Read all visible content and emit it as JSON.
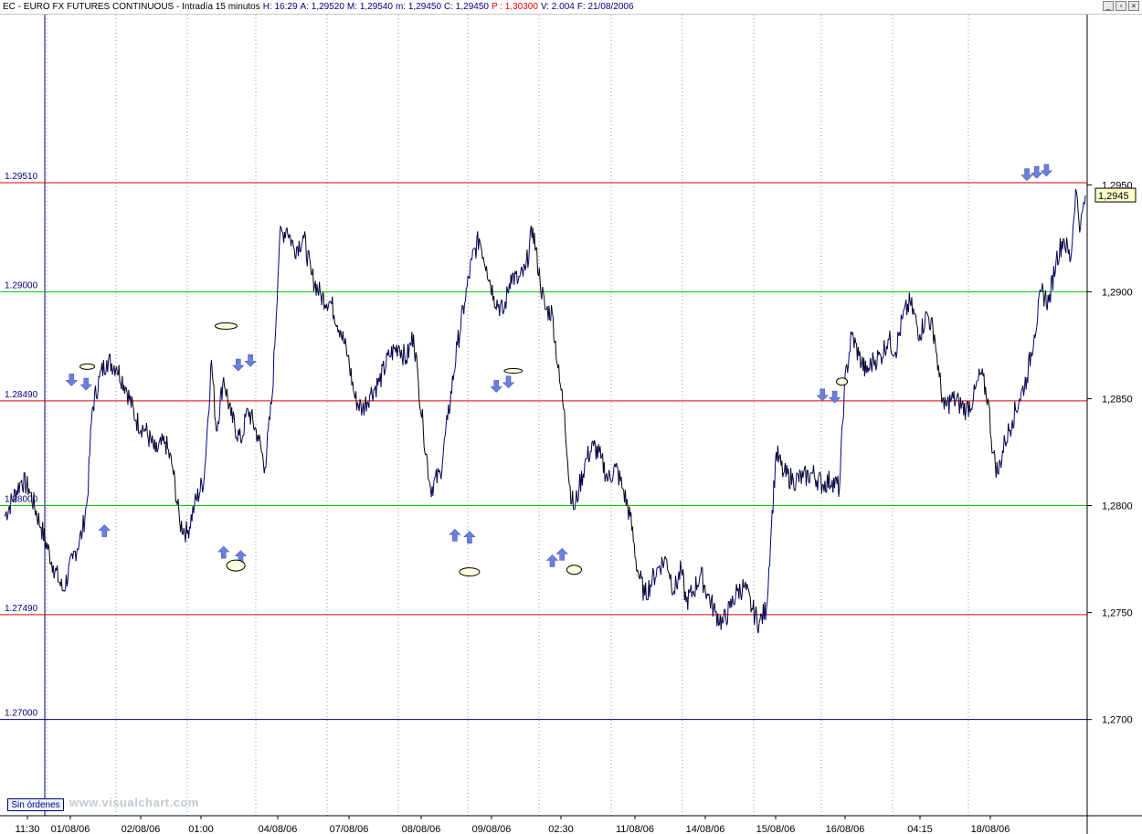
{
  "window": {
    "title_parts": [
      {
        "label": "EC - EURO FX FUTURES CONTINUOUS - Intradía 15 minutos",
        "value": "",
        "color": "#000000"
      },
      {
        "label": "H:",
        "value": "16:29",
        "color": "#000080"
      },
      {
        "label": "A:",
        "value": "1,29520",
        "color": "#000080"
      },
      {
        "label": "M:",
        "value": "1,29540",
        "color": "#000080"
      },
      {
        "label": "m:",
        "value": "1,29450",
        "color": "#000080"
      },
      {
        "label": "C:",
        "value": "1,29450",
        "color": "#000080"
      },
      {
        "label": "P :",
        "value": "1,30300",
        "color": "#ff0000"
      },
      {
        "label": "V:",
        "value": "2.004",
        "color": "#000080"
      },
      {
        "label": "F:",
        "value": "21/08/2006",
        "color": "#000080"
      }
    ],
    "buttons": [
      "_",
      "▫",
      "×"
    ]
  },
  "footer": {
    "orders_button": "Sin órdenes",
    "watermark": "www.visualchart.com"
  },
  "colors": {
    "bull": "#000080",
    "bear": "#000000",
    "red_level": "#e00000",
    "green_level": "#00c000",
    "blue_level": "#000080",
    "signal": "#6c7fd8"
  },
  "chart_data": {
    "type": "line",
    "title": "EC - EURO FX FUTURES CONTINUOUS - Intradía 15 minutos",
    "ylim": [
      1.2655,
      1.30296
    ],
    "last_value": 1.2945,
    "last_value_label": "1,2945",
    "y_ticks": [
      {
        "value": 1.295,
        "label": "1,2950"
      },
      {
        "value": 1.29,
        "label": "1,2900"
      },
      {
        "value": 1.285,
        "label": "1,2850"
      },
      {
        "value": 1.28,
        "label": "1,2800"
      },
      {
        "value": 1.275,
        "label": "1,2750"
      },
      {
        "value": 1.27,
        "label": "1,2700"
      }
    ],
    "x_ticks": [
      "11:30",
      "01/08/06",
      "02/08/06",
      "01:00",
      "04/08/06",
      "07/08/06",
      "08/08/06",
      "09/08/06",
      "02:30",
      "11/08/06",
      "14/08/06",
      "15/08/06",
      "16/08/06",
      "04:15",
      "18/08/06"
    ],
    "levels": [
      {
        "value": 1.2951,
        "label": "1.29510",
        "color": "red"
      },
      {
        "value": 1.29,
        "label": "1.29000",
        "color": "green"
      },
      {
        "value": 1.2849,
        "label": "1.28490",
        "color": "red"
      },
      {
        "value": 1.28,
        "label": "1.28000",
        "color": "green"
      },
      {
        "value": 1.2749,
        "label": "1.27490",
        "color": "red"
      },
      {
        "value": 1.27,
        "label": "1.27000",
        "color": "blue"
      }
    ],
    "series_path": [
      [
        0,
        1.2795
      ],
      [
        0.7,
        1.2812
      ],
      [
        1.0,
        1.2808
      ],
      [
        1.5,
        1.279
      ],
      [
        2.0,
        1.2772
      ],
      [
        2.4,
        1.276
      ],
      [
        2.8,
        1.2775
      ],
      [
        3.2,
        1.2788
      ],
      [
        3.4,
        1.2803
      ],
      [
        3.6,
        1.2845
      ],
      [
        3.9,
        1.286
      ],
      [
        4.2,
        1.2868
      ],
      [
        4.6,
        1.2865
      ],
      [
        5.0,
        1.2855
      ],
      [
        5.4,
        1.284
      ],
      [
        5.8,
        1.2835
      ],
      [
        6.2,
        1.2825
      ],
      [
        6.6,
        1.283
      ],
      [
        6.9,
        1.2818
      ],
      [
        7.2,
        1.2792
      ],
      [
        7.5,
        1.2787
      ],
      [
        7.8,
        1.28
      ],
      [
        8.2,
        1.2813
      ],
      [
        8.5,
        1.2868
      ],
      [
        8.7,
        1.2835
      ],
      [
        9.0,
        1.286
      ],
      [
        9.3,
        1.2842
      ],
      [
        9.7,
        1.283
      ],
      [
        10.0,
        1.2845
      ],
      [
        10.4,
        1.2833
      ],
      [
        10.7,
        1.2818
      ],
      [
        11.0,
        1.2852
      ],
      [
        11.3,
        1.2925
      ],
      [
        11.6,
        1.293
      ],
      [
        11.9,
        1.292
      ],
      [
        12.3,
        1.2925
      ],
      [
        12.6,
        1.2908
      ],
      [
        13.0,
        1.2898
      ],
      [
        13.4,
        1.2895
      ],
      [
        13.8,
        1.2882
      ],
      [
        14.1,
        1.287
      ],
      [
        14.4,
        1.285
      ],
      [
        14.7,
        1.2845
      ],
      [
        15.0,
        1.2852
      ],
      [
        15.4,
        1.2858
      ],
      [
        15.8,
        1.287
      ],
      [
        16.2,
        1.2875
      ],
      [
        16.5,
        1.2868
      ],
      [
        16.8,
        1.288
      ],
      [
        17.0,
        1.2858
      ],
      [
        17.2,
        1.2836
      ],
      [
        17.5,
        1.2808
      ],
      [
        17.9,
        1.2815
      ],
      [
        18.2,
        1.284
      ],
      [
        18.6,
        1.2875
      ],
      [
        18.9,
        1.2895
      ],
      [
        19.2,
        1.2915
      ],
      [
        19.5,
        1.2925
      ],
      [
        19.8,
        1.2912
      ],
      [
        20.1,
        1.2898
      ],
      [
        20.5,
        1.289
      ],
      [
        20.8,
        1.2908
      ],
      [
        21.1,
        1.2905
      ],
      [
        21.4,
        1.291
      ],
      [
        21.7,
        1.293
      ],
      [
        22.0,
        1.2905
      ],
      [
        22.2,
        1.2892
      ],
      [
        22.5,
        1.289
      ],
      [
        22.8,
        1.2858
      ],
      [
        23.0,
        1.2845
      ],
      [
        23.2,
        1.281
      ],
      [
        23.4,
        1.2798
      ],
      [
        23.6,
        1.2808
      ],
      [
        23.9,
        1.2822
      ],
      [
        24.2,
        1.2828
      ],
      [
        24.5,
        1.2822
      ],
      [
        24.8,
        1.2812
      ],
      [
        25.1,
        1.2818
      ],
      [
        25.4,
        1.2808
      ],
      [
        25.7,
        1.2795
      ],
      [
        26.0,
        1.277
      ],
      [
        26.3,
        1.2758
      ],
      [
        26.6,
        1.2765
      ],
      [
        26.9,
        1.2772
      ],
      [
        27.2,
        1.2775
      ],
      [
        27.5,
        1.276
      ],
      [
        27.8,
        1.277
      ],
      [
        28.0,
        1.2755
      ],
      [
        28.3,
        1.276
      ],
      [
        28.6,
        1.2768
      ],
      [
        28.9,
        1.2758
      ],
      [
        29.2,
        1.275
      ],
      [
        29.5,
        1.2745
      ],
      [
        29.8,
        1.2752
      ],
      [
        30.1,
        1.276
      ],
      [
        30.4,
        1.2762
      ],
      [
        30.7,
        1.2752
      ],
      [
        31.0,
        1.2745
      ],
      [
        31.3,
        1.2752
      ],
      [
        31.5,
        1.279
      ],
      [
        31.7,
        1.2825
      ],
      [
        32.0,
        1.2815
      ],
      [
        32.4,
        1.2812
      ],
      [
        32.8,
        1.2813
      ],
      [
        33.2,
        1.2815
      ],
      [
        33.6,
        1.281
      ],
      [
        34.0,
        1.2812
      ],
      [
        34.3,
        1.2808
      ],
      [
        34.5,
        1.2855
      ],
      [
        34.8,
        1.288
      ],
      [
        35.1,
        1.287
      ],
      [
        35.4,
        1.2862
      ],
      [
        35.7,
        1.2868
      ],
      [
        36.0,
        1.287
      ],
      [
        36.3,
        1.2878
      ],
      [
        36.6,
        1.2872
      ],
      [
        36.9,
        1.2888
      ],
      [
        37.2,
        1.2895
      ],
      [
        37.6,
        1.288
      ],
      [
        37.9,
        1.289
      ],
      [
        38.2,
        1.288
      ],
      [
        38.4,
        1.286
      ],
      [
        38.6,
        1.2845
      ],
      [
        38.9,
        1.285
      ],
      [
        39.2,
        1.2848
      ],
      [
        39.5,
        1.2845
      ],
      [
        39.8,
        1.285
      ],
      [
        40.1,
        1.2862
      ],
      [
        40.4,
        1.285
      ],
      [
        40.6,
        1.2825
      ],
      [
        40.8,
        1.2815
      ],
      [
        41.1,
        1.283
      ],
      [
        41.4,
        1.284
      ],
      [
        41.7,
        1.285
      ],
      [
        42.0,
        1.286
      ],
      [
        42.3,
        1.288
      ],
      [
        42.6,
        1.29
      ],
      [
        42.9,
        1.2895
      ],
      [
        43.2,
        1.2915
      ],
      [
        43.5,
        1.2925
      ],
      [
        43.8,
        1.2915
      ],
      [
        44.0,
        1.2948
      ],
      [
        44.2,
        1.293
      ],
      [
        44.4,
        1.2945
      ]
    ],
    "signals": [
      {
        "kind": "down",
        "pos": [
          2.75,
          1.2859
        ]
      },
      {
        "kind": "down",
        "pos": [
          3.35,
          1.2857
        ]
      },
      {
        "kind": "up",
        "pos": [
          4.1,
          1.2788
        ]
      },
      {
        "kind": "up",
        "pos": [
          9.0,
          1.2778
        ]
      },
      {
        "kind": "up",
        "pos": [
          9.7,
          1.2776
        ]
      },
      {
        "kind": "down",
        "pos": [
          9.6,
          1.2866
        ]
      },
      {
        "kind": "down",
        "pos": [
          10.1,
          1.2868
        ]
      },
      {
        "kind": "up",
        "pos": [
          18.5,
          1.2786
        ]
      },
      {
        "kind": "up",
        "pos": [
          19.1,
          1.2785
        ]
      },
      {
        "kind": "down",
        "pos": [
          20.2,
          1.2856
        ]
      },
      {
        "kind": "down",
        "pos": [
          20.7,
          1.2858
        ]
      },
      {
        "kind": "up",
        "pos": [
          22.5,
          1.2774
        ]
      },
      {
        "kind": "up",
        "pos": [
          22.9,
          1.2777
        ]
      },
      {
        "kind": "down",
        "pos": [
          33.6,
          1.2852
        ]
      },
      {
        "kind": "down",
        "pos": [
          34.1,
          1.2851
        ]
      },
      {
        "kind": "down",
        "pos": [
          42.0,
          1.2955
        ]
      },
      {
        "kind": "down",
        "pos": [
          42.4,
          1.2956
        ]
      },
      {
        "kind": "down",
        "pos": [
          42.8,
          1.2957
        ]
      }
    ],
    "ellipses": [
      {
        "pos": [
          3.4,
          1.2865
        ],
        "rx": 8,
        "ry": 3
      },
      {
        "pos": [
          9.1,
          1.2884
        ],
        "rx": 12,
        "ry": 3.5
      },
      {
        "pos": [
          9.5,
          1.2772
        ],
        "rx": 10,
        "ry": 6
      },
      {
        "pos": [
          20.9,
          1.2863
        ],
        "rx": 10,
        "ry": 2.5
      },
      {
        "pos": [
          19.1,
          1.2769
        ],
        "rx": 11,
        "ry": 4.5
      },
      {
        "pos": [
          23.4,
          1.277
        ],
        "rx": 8,
        "ry": 5
      },
      {
        "pos": [
          34.4,
          1.2858
        ],
        "rx": 6,
        "ry": 4
      }
    ]
  }
}
